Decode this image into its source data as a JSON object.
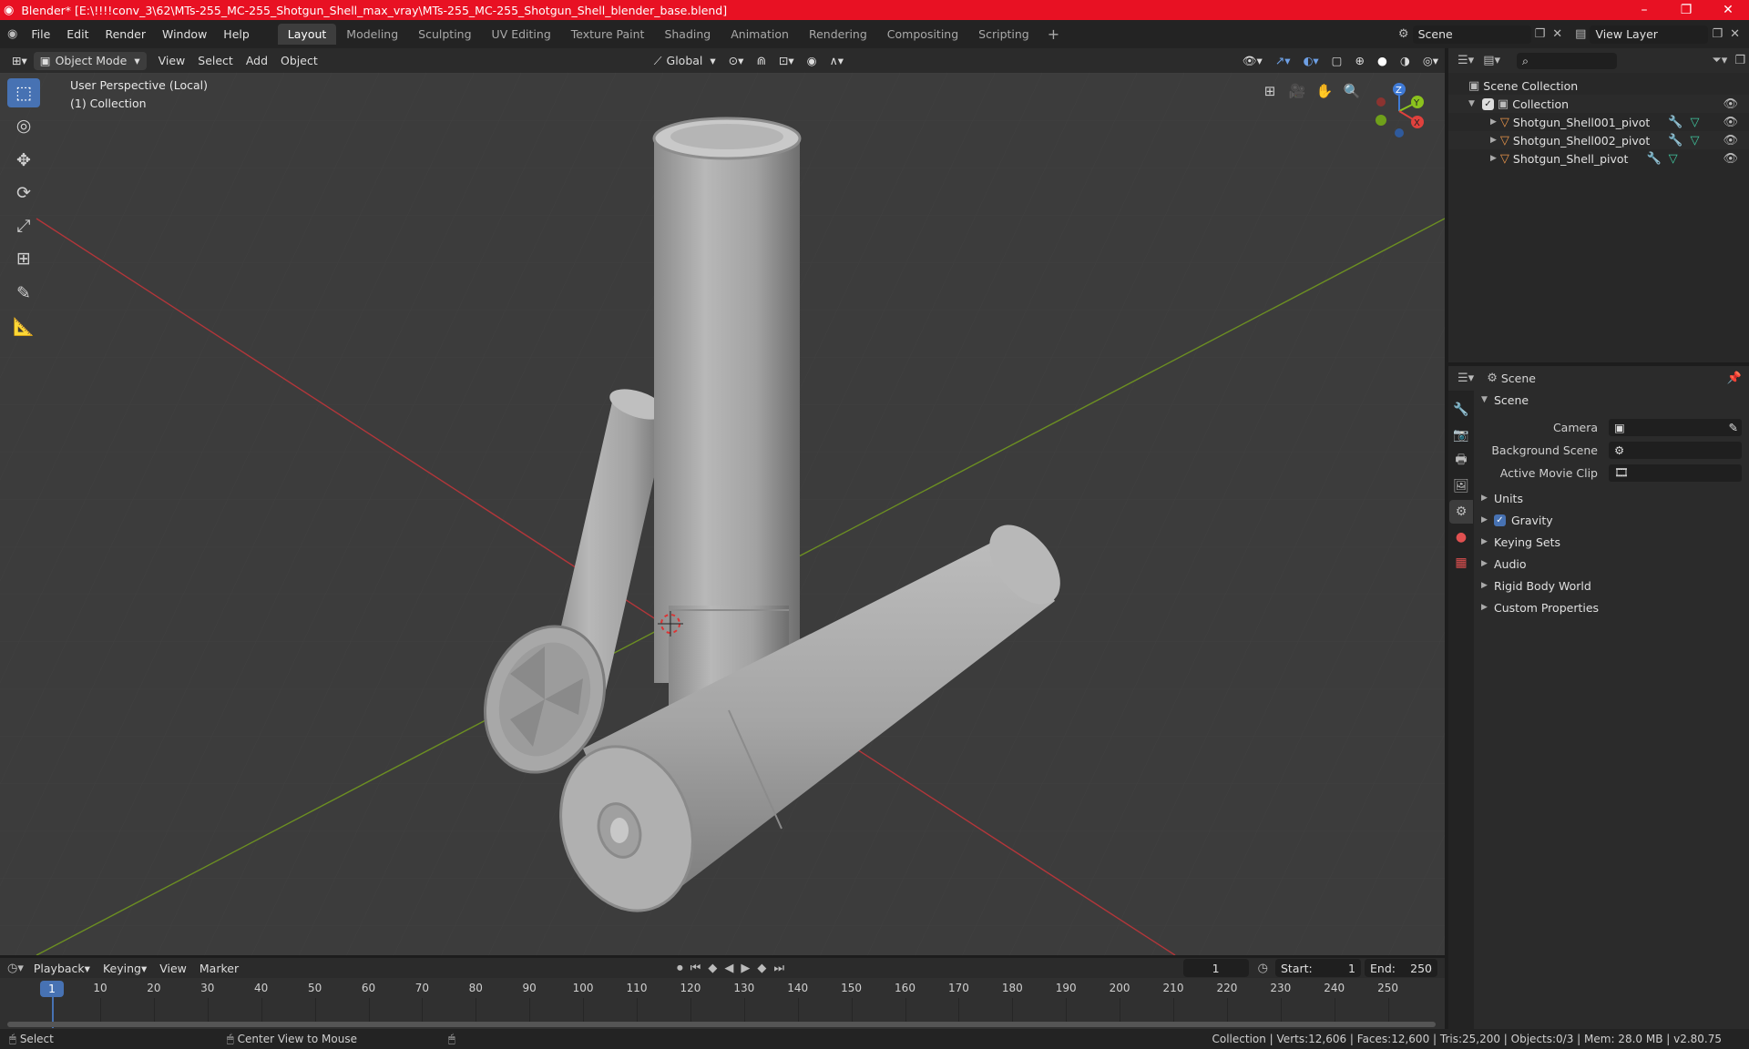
{
  "window": {
    "title": "Blender* [E:\\!!!!conv_3\\62\\MTs-255_MC-255_Shotgun_Shell_max_vray\\MTs-255_MC-255_Shotgun_Shell_blender_base.blend]",
    "minimize": "–",
    "maximize": "❐",
    "close": "✕"
  },
  "menu": {
    "items": [
      "File",
      "Edit",
      "Render",
      "Window",
      "Help"
    ]
  },
  "workspaces": [
    "Layout",
    "Modeling",
    "Sculpting",
    "UV Editing",
    "Texture Paint",
    "Shading",
    "Animation",
    "Rendering",
    "Compositing",
    "Scripting"
  ],
  "active_workspace": "Layout",
  "scene_field": "Scene",
  "view_layer_field": "View Layer",
  "viewport_header": {
    "mode": "Object Mode",
    "view": "View",
    "select": "Select",
    "add": "Add",
    "object": "Object",
    "orientation": "Global"
  },
  "viewport_overlay": {
    "perspective": "User Perspective (Local)",
    "collection": "(1) Collection"
  },
  "gizmo": {
    "x": "X",
    "y": "Y",
    "z": "Z",
    "colors": {
      "x": "#e0413d",
      "y": "#8bc21d",
      "z": "#3f7ad6"
    }
  },
  "outliner": {
    "root": "Scene Collection",
    "collection": "Collection",
    "objects": [
      "Shotgun_Shell001_pivot",
      "Shotgun_Shell002_pivot",
      "Shotgun_Shell_pivot"
    ]
  },
  "properties": {
    "header": "Scene",
    "panel": "Scene",
    "camera_label": "Camera",
    "background_label": "Background Scene",
    "movie_clip_label": "Active Movie Clip",
    "sections": [
      "Units",
      "Gravity",
      "Keying Sets",
      "Audio",
      "Rigid Body World",
      "Custom Properties"
    ],
    "gravity_checked": true
  },
  "timeline": {
    "playback": "Playback",
    "keying": "Keying",
    "view": "View",
    "marker": "Marker",
    "current_frame": "1",
    "start_label": "Start:",
    "start": "1",
    "end_label": "End:",
    "end": "250",
    "ticks": [
      "10",
      "20",
      "30",
      "40",
      "50",
      "60",
      "70",
      "80",
      "90",
      "100",
      "110",
      "120",
      "130",
      "140",
      "150",
      "160",
      "170",
      "180",
      "190",
      "200",
      "210",
      "220",
      "230",
      "240",
      "250"
    ],
    "cursor_frame": "1"
  },
  "statusbar": {
    "left": "Select",
    "middle": "Center View to Mouse",
    "right": "Collection | Verts:12,606 | Faces:12,600 | Tris:25,200 | Objects:0/3 | Mem: 28.0 MB | v2.80.75"
  },
  "colors": {
    "title_bar": "#e81123",
    "accent": "#4772b3",
    "x_axis": "#b3363a",
    "y_axis": "#6c8f22"
  }
}
